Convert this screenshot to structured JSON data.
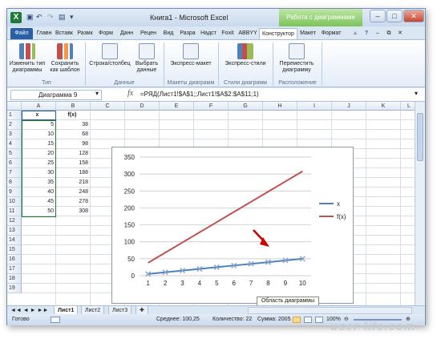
{
  "window": {
    "title": "Книга1 - Microsoft Excel",
    "context_title": "Работа с диаграммами"
  },
  "tabs": [
    "Файл",
    "Главн",
    "Вставк",
    "Размк",
    "Форм",
    "Данн",
    "Рецен",
    "Вид",
    "Разра",
    "Надст",
    "Foxit",
    "ABBYY",
    "Конструктор",
    "Макет",
    "Формат"
  ],
  "ribbon": {
    "buttons": [
      {
        "label": "Изменить тип диаграммы"
      },
      {
        "label": "Сохранить как шаблон"
      },
      {
        "label": "Строка/столбец"
      },
      {
        "label": "Выбрать данные"
      },
      {
        "label": "Экспресс-макет"
      },
      {
        "label": "Экспресс-стили"
      },
      {
        "label": "Переместить диаграмму"
      }
    ],
    "groups": [
      "Тип",
      "Данные",
      "Макеты диаграмм",
      "Стили диаграмм",
      "Расположение"
    ]
  },
  "formula_bar": {
    "name_box": "Диаграмма 9",
    "fx": "fx",
    "formula": "=РЯД(Лист1!$A$1;;Лист1!$A$2:$A$11;1)"
  },
  "columns": [
    "A",
    "B",
    "C",
    "D",
    "E",
    "F",
    "G",
    "H",
    "I",
    "J",
    "K",
    "L"
  ],
  "rows": [
    "1",
    "2",
    "3",
    "4",
    "5",
    "6",
    "7",
    "8",
    "9",
    "10",
    "11",
    "12",
    "13",
    "14",
    "15",
    "16",
    "17",
    "18",
    "19"
  ],
  "table": {
    "headers": [
      "x",
      "f(x)"
    ],
    "x": [
      "5",
      "10",
      "15",
      "20",
      "25",
      "30",
      "35",
      "40",
      "45",
      "50"
    ],
    "fx": [
      "38",
      "68",
      "98",
      "128",
      "158",
      "188",
      "218",
      "248",
      "278",
      "308"
    ]
  },
  "chart_data": {
    "type": "line",
    "categories": [
      "1",
      "2",
      "3",
      "4",
      "5",
      "6",
      "7",
      "8",
      "9",
      "10"
    ],
    "series": [
      {
        "name": "x",
        "values": [
          5,
          10,
          15,
          20,
          25,
          30,
          35,
          40,
          45,
          50
        ],
        "color": "#4f81bd"
      },
      {
        "name": "f(x)",
        "values": [
          38,
          68,
          98,
          128,
          158,
          188,
          218,
          248,
          278,
          308
        ],
        "color": "#c0504d"
      }
    ],
    "ylim": [
      0,
      350
    ],
    "yticks": [
      "0",
      "50",
      "100",
      "150",
      "200",
      "250",
      "300",
      "350"
    ],
    "grid": true,
    "legend": "right",
    "annotation": "red arrow pointing at series x"
  },
  "tooltip": "Область диаграммы",
  "sheet_tabs": [
    "Лист1",
    "Лист2",
    "Лист3"
  ],
  "status": {
    "ready": "Готово",
    "average": "Среднее: 100,25",
    "count": "Количество: 22",
    "sum": "Сумма: 2005",
    "zoom": "100%"
  },
  "watermark": "user-life.com"
}
